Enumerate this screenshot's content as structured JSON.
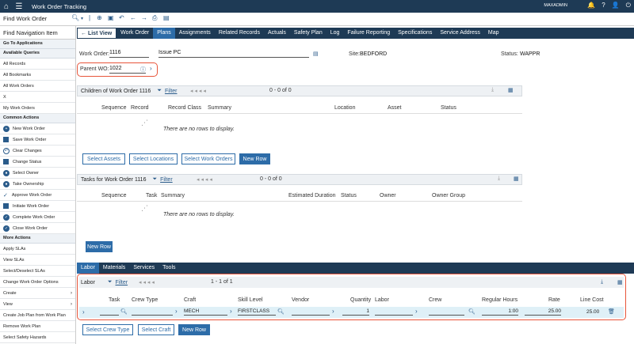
{
  "topbar": {
    "app_title": "Work Order Tracking",
    "user": "MAXADMIN"
  },
  "toolbar": {
    "find_placeholder": "Find Work Order"
  },
  "sidebar": {
    "find_label": "Find Navigation Item",
    "goto_label": "Go To Applications",
    "queries_label": "Available Queries",
    "queries": [
      "All Records",
      "All Bookmarks",
      "All Work Orders",
      "X",
      "My Work Orders"
    ],
    "common_label": "Common Actions",
    "common": [
      "New Work Order",
      "Save Work Order",
      "Clear Changes",
      "Change Status",
      "Select Owner",
      "Take Ownership",
      "Approve Work Order",
      "Initiate Work Order",
      "Complete Work Order",
      "Close Work Order"
    ],
    "more_label": "More Actions",
    "more": [
      "Apply SLAs",
      "View SLAs",
      "Select/Deselect SLAs",
      "Change Work Order Options",
      "Create",
      "View",
      "Create Job Plan from Work Plan",
      "Remove Work Plan",
      "Select Safety Hazards"
    ]
  },
  "tabs": {
    "list_view": "List View",
    "items": [
      "Work Order",
      "Plans",
      "Assignments",
      "Related Records",
      "Actuals",
      "Safety Plan",
      "Log",
      "Failure Reporting",
      "Specifications",
      "Service Address",
      "Map"
    ]
  },
  "header": {
    "wo_label": "Work Order:",
    "wo_value": "1116",
    "wo_desc": "Issue PC",
    "site_label": "Site:",
    "site_value": "BEDFORD",
    "status_label": "Status:",
    "status_value": "WAPPR",
    "parent_label": "Parent WO:",
    "parent_value": "1022"
  },
  "children": {
    "title": "Children of Work Order 1116",
    "filter": "Filter",
    "pager": "0 - 0 of 0",
    "cols": [
      "Sequence",
      "Record",
      "Record Class",
      "Summary",
      "Location",
      "Asset",
      "Status"
    ],
    "norows": "There are no rows to display.",
    "buttons": [
      "Select Assets",
      "Select Locations",
      "Select Work Orders",
      "New Row"
    ]
  },
  "tasks": {
    "title": "Tasks for Work Order 1116",
    "filter": "Filter",
    "pager": "0 - 0 of 0",
    "cols": [
      "Sequence",
      "Task",
      "Summary",
      "Estimated Duration",
      "Status",
      "Owner",
      "Owner Group"
    ],
    "norows": "There are no rows to display.",
    "new_row": "New Row"
  },
  "bottom_tabs": [
    "Labor",
    "Materials",
    "Services",
    "Tools"
  ],
  "labor": {
    "title": "Labor",
    "filter": "Filter",
    "pager": "1 - 1 of 1",
    "cols": [
      "Task",
      "Crew Type",
      "Craft",
      "Skill Level",
      "Vendor",
      "Quantity",
      "Labor",
      "Crew",
      "Regular Hours",
      "Rate",
      "Line Cost"
    ],
    "row": {
      "craft": "MECH",
      "skill": "FIRSTCLASS",
      "quantity": "1",
      "hours": "1:00",
      "rate": "25.00",
      "line_cost": "25.00"
    },
    "buttons": [
      "Select Crew Type",
      "Select Craft",
      "New Row"
    ]
  },
  "colors": {
    "nav": "#1e3a55",
    "accent": "#2d6ca8",
    "highlight": "#e8553a"
  }
}
